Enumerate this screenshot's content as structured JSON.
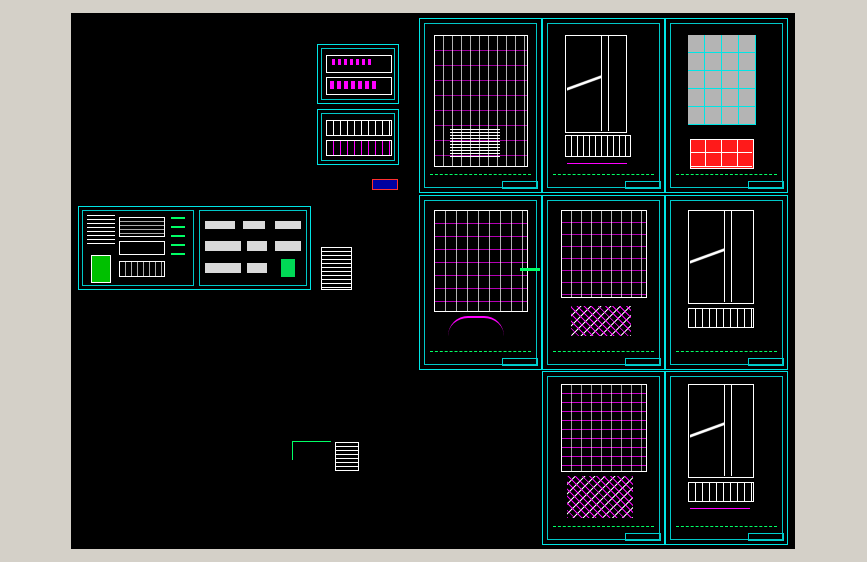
{
  "viewport": {
    "background": "#000000",
    "frame": "#d4d0c8"
  },
  "colors": {
    "cyan": "#00e5e5",
    "magenta": "#ff00ff",
    "green": "#00ff66",
    "white": "#ffffff",
    "red": "#ff1a1a",
    "gray": "#b4b4b4"
  },
  "sheets": [
    {
      "id": "plan-basement-1",
      "kind": "floor-plan"
    },
    {
      "id": "plan-upper-section",
      "kind": "section"
    },
    {
      "id": "plan-roof-gray",
      "kind": "roof-plan"
    },
    {
      "id": "plan-basement-2",
      "kind": "floor-plan"
    },
    {
      "id": "plan-ground",
      "kind": "floor-plan"
    },
    {
      "id": "plan-section-2",
      "kind": "section"
    },
    {
      "id": "plan-ground-2",
      "kind": "floor-plan"
    },
    {
      "id": "plan-section-3",
      "kind": "section"
    },
    {
      "id": "notes-sheet",
      "kind": "notes"
    },
    {
      "id": "detail-sheet",
      "kind": "details"
    },
    {
      "id": "small-plan-top",
      "kind": "small-plan"
    },
    {
      "id": "small-plan-bottom",
      "kind": "small-plan"
    }
  ]
}
